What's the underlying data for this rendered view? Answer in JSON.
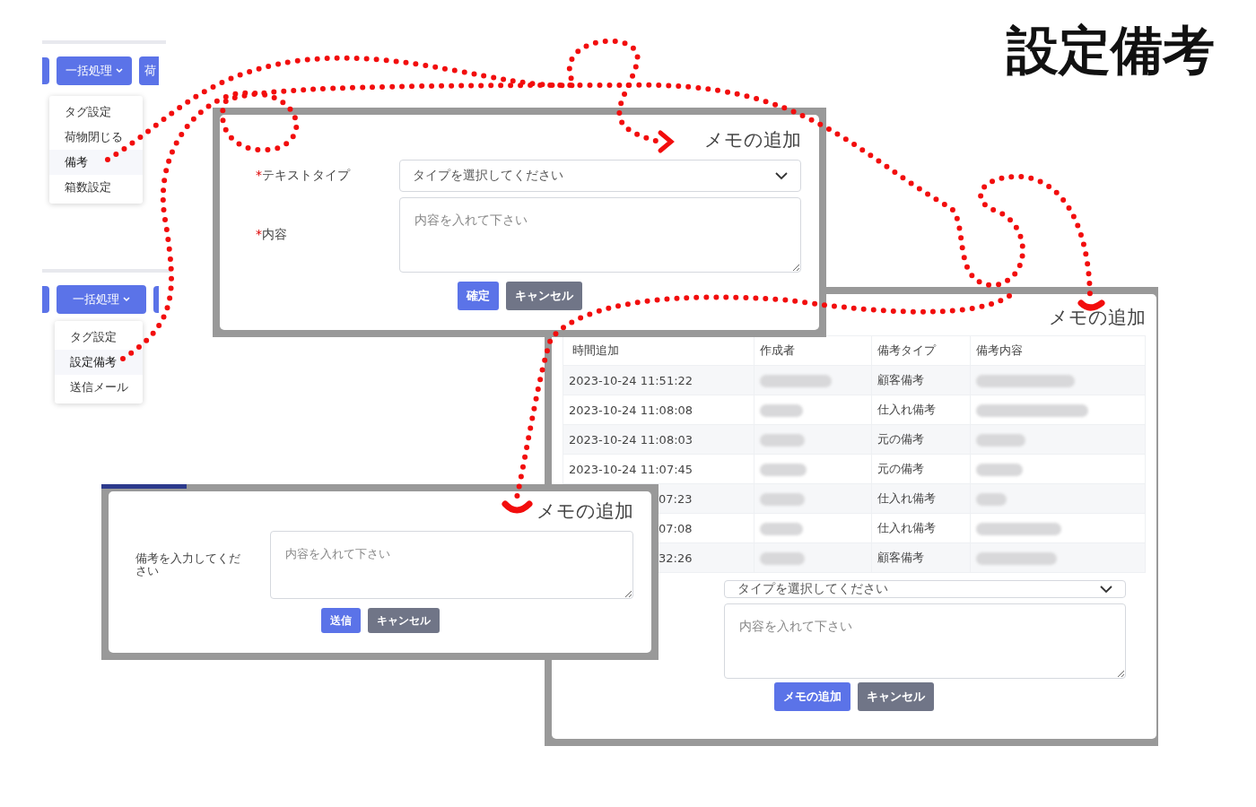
{
  "title": "設定備考",
  "menus": [
    {
      "button": "一括処理",
      "next_button": "荷",
      "items": [
        {
          "label": "タグ設定",
          "selected": false
        },
        {
          "label": "荷物閉じる",
          "selected": false
        },
        {
          "label": "備考",
          "selected": true
        },
        {
          "label": "箱数設定",
          "selected": false
        }
      ]
    },
    {
      "button": "一括処理",
      "items": [
        {
          "label": "タグ設定",
          "selected": false
        },
        {
          "label": "設定備考",
          "selected": true
        },
        {
          "label": "送信メール",
          "selected": false
        }
      ]
    }
  ],
  "dialogs": [
    {
      "kind": "form",
      "title": "メモの追加",
      "fields": [
        {
          "mark": "*",
          "label": "テキストタイプ",
          "kind": "select",
          "placeholder": "タイプを選択してください"
        },
        {
          "mark": "*",
          "label": "内容",
          "kind": "textarea",
          "placeholder": "内容を入れて下さい"
        }
      ],
      "buttons": [
        {
          "label": "確定",
          "kind": "primary"
        },
        {
          "label": "キャンセル",
          "kind": "secondary"
        }
      ]
    },
    {
      "kind": "table",
      "title": "メモの追加",
      "columns": [
        "時間追加",
        "作成者",
        "備考タイプ",
        "備考内容"
      ],
      "rows": [
        {
          "time": "2023-10-24 11:51:22",
          "clipped": false,
          "type": "顧客備考"
        },
        {
          "time": "2023-10-24 11:08:08",
          "clipped": false,
          "type": "仕入れ備考"
        },
        {
          "time": "2023-10-24 11:08:03",
          "clipped": false,
          "type": "元の備考"
        },
        {
          "time": "2023-10-24 11:07:45",
          "clipped": false,
          "type": "元の備考"
        },
        {
          "time": "07:23",
          "clipped": true,
          "type": "仕入れ備考"
        },
        {
          "time": "07:08",
          "clipped": true,
          "type": "仕入れ備考"
        },
        {
          "time": "32:26",
          "clipped": true,
          "type": "顧客備考"
        }
      ],
      "fields": [
        {
          "kind": "select",
          "placeholder": "タイプを選択してください"
        },
        {
          "kind": "textarea",
          "placeholder": "内容を入れて下さい"
        }
      ],
      "buttons": [
        {
          "label": "メモの追加",
          "kind": "primary"
        },
        {
          "label": "キャンセル",
          "kind": "secondary"
        }
      ]
    },
    {
      "kind": "small",
      "title": "メモの追加",
      "fields": [
        {
          "label": "備考を入力してください",
          "kind": "textarea",
          "placeholder": "内容を入れて下さい"
        }
      ],
      "buttons": [
        {
          "label": "送信",
          "kind": "primary"
        },
        {
          "label": "キャンセル",
          "kind": "secondary"
        }
      ]
    }
  ]
}
